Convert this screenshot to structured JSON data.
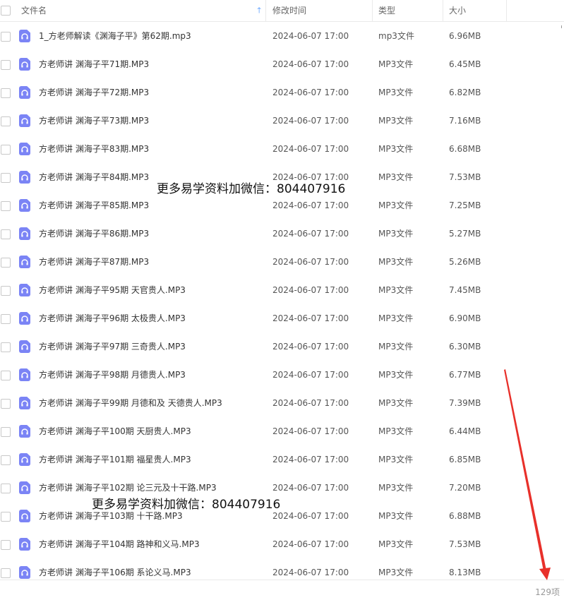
{
  "header": {
    "name": "文件名",
    "time": "修改时间",
    "type": "类型",
    "size": "大小",
    "sort_icon": "arrow-up-icon"
  },
  "files": [
    {
      "name": "1_方老师解读《渊海子平》第62期.mp3",
      "time": "2024-06-07 17:00",
      "type": "mp3文件",
      "size": "6.96MB"
    },
    {
      "name": "方老师讲 渊海子平71期.MP3",
      "time": "2024-06-07 17:00",
      "type": "MP3文件",
      "size": "6.45MB"
    },
    {
      "name": "方老师讲 渊海子平72期.MP3",
      "time": "2024-06-07 17:00",
      "type": "MP3文件",
      "size": "6.82MB"
    },
    {
      "name": "方老师讲 渊海子平73期.MP3",
      "time": "2024-06-07 17:00",
      "type": "MP3文件",
      "size": "7.16MB"
    },
    {
      "name": "方老师讲 渊海子平83期.MP3",
      "time": "2024-06-07 17:00",
      "type": "MP3文件",
      "size": "6.68MB"
    },
    {
      "name": "方老师讲 渊海子平84期.MP3",
      "time": "2024-06-07 17:00",
      "type": "MP3文件",
      "size": "7.53MB"
    },
    {
      "name": "方老师讲 渊海子平85期.MP3",
      "time": "2024-06-07 17:00",
      "type": "MP3文件",
      "size": "7.25MB"
    },
    {
      "name": "方老师讲 渊海子平86期.MP3",
      "time": "2024-06-07 17:00",
      "type": "MP3文件",
      "size": "5.27MB"
    },
    {
      "name": "方老师讲 渊海子平87期.MP3",
      "time": "2024-06-07 17:00",
      "type": "MP3文件",
      "size": "5.26MB"
    },
    {
      "name": "方老师讲 渊海子平95期 天官贵人.MP3",
      "time": "2024-06-07 17:00",
      "type": "MP3文件",
      "size": "7.45MB"
    },
    {
      "name": "方老师讲 渊海子平96期 太极贵人.MP3",
      "time": "2024-06-07 17:00",
      "type": "MP3文件",
      "size": "6.90MB"
    },
    {
      "name": "方老师讲 渊海子平97期 三奇贵人.MP3",
      "time": "2024-06-07 17:00",
      "type": "MP3文件",
      "size": "6.30MB"
    },
    {
      "name": "方老师讲 渊海子平98期 月德贵人.MP3",
      "time": "2024-06-07 17:00",
      "type": "MP3文件",
      "size": "6.77MB"
    },
    {
      "name": "方老师讲 渊海子平99期 月德和及 天德贵人.MP3",
      "time": "2024-06-07 17:00",
      "type": "MP3文件",
      "size": "7.39MB"
    },
    {
      "name": "方老师讲 渊海子平100期 天厨贵人.MP3",
      "time": "2024-06-07 17:00",
      "type": "MP3文件",
      "size": "6.44MB"
    },
    {
      "name": "方老师讲 渊海子平101期 福星贵人.MP3",
      "time": "2024-06-07 17:00",
      "type": "MP3文件",
      "size": "6.85MB"
    },
    {
      "name": "方老师讲 渊海子平102期 论三元及十干路.MP3",
      "time": "2024-06-07 17:00",
      "type": "MP3文件",
      "size": "7.20MB"
    },
    {
      "name": "方老师讲 渊海子平103期 十干路.MP3",
      "time": "2024-06-07 17:00",
      "type": "MP3文件",
      "size": "6.88MB"
    },
    {
      "name": "方老师讲 渊海子平104期 路神和义马.MP3",
      "time": "2024-06-07 17:00",
      "type": "MP3文件",
      "size": "7.53MB"
    },
    {
      "name": "方老师讲 渊海子平106期 系论义马.MP3",
      "time": "2024-06-07 17:00",
      "type": "MP3文件",
      "size": "8.13MB"
    }
  ],
  "file_icon": "audio-file-icon",
  "watermark": "更多易学资料加微信：804407916",
  "footer": {
    "count": "129项"
  },
  "colors": {
    "file_icon": "#7b84f5",
    "sort_arrow": "#3b8cff",
    "annotation_arrow": "#e8302a"
  }
}
